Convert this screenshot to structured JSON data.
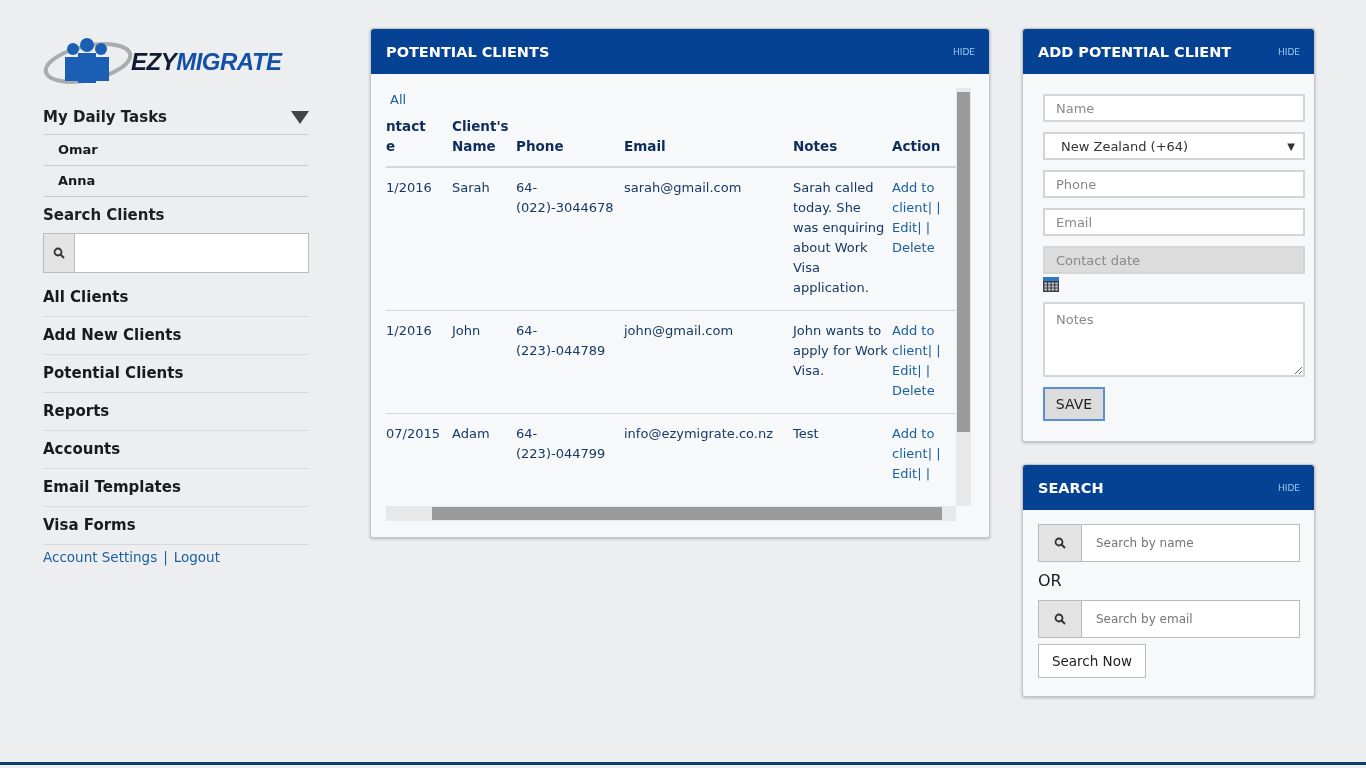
{
  "logo": {
    "part_1": "EZY",
    "part_2": "MIGRATE"
  },
  "sidebar": {
    "tasks": {
      "label": "My Daily Tasks",
      "expanded": true,
      "children": [
        {
          "label": "Omar"
        },
        {
          "label": "Anna"
        }
      ]
    },
    "search_heading": "Search Clients",
    "nav": [
      {
        "label": "All Clients"
      },
      {
        "label": "Add New Clients"
      },
      {
        "label": "Potential Clients"
      },
      {
        "label": "Reports"
      },
      {
        "label": "Accounts"
      },
      {
        "label": "Email Templates"
      },
      {
        "label": "Visa Forms"
      }
    ],
    "footer_links": [
      {
        "label": "Account Settings",
        "sep": "|"
      },
      {
        "label": "Logout"
      }
    ]
  },
  "potential_clients": {
    "title": "POTENTIAL CLIENTS",
    "hide": "HIDE",
    "view_all": "All",
    "columns": [
      {
        "line_1": "ntact",
        "line_2": "e"
      },
      {
        "line_1": "Client's",
        "line_2": "Name"
      },
      {
        "line_2": "Phone"
      },
      {
        "line_2": "Email"
      },
      {
        "line_2": "Notes"
      },
      {
        "line_2": "Action"
      }
    ],
    "rows": [
      {
        "date": "1/2016",
        "name": "Sarah",
        "phone": "64-(022)-3044678",
        "email": "sarah@gmail.com",
        "notes": "Sarah called today. She was enquiring about Work Visa application.",
        "actions": [
          {
            "label": "Add to client",
            "sep": "| |"
          },
          {
            "label": "Edit",
            "sep": "| |"
          },
          {
            "label": "Delete"
          }
        ]
      },
      {
        "date": "1/2016",
        "name": "John",
        "phone": "64-(223)-044789",
        "email": "john@gmail.com",
        "notes": "John wants to apply for Work Visa.",
        "actions": [
          {
            "label": "Add to client",
            "sep": "| |"
          },
          {
            "label": "Edit",
            "sep": "| |"
          },
          {
            "label": "Delete"
          }
        ]
      },
      {
        "date": "07/2015",
        "name": "Adam",
        "phone": "64-(223)-044799",
        "email": "info@ezymigrate.co.nz",
        "notes": "Test",
        "actions": [
          {
            "label": "Add to client",
            "sep": "| |"
          },
          {
            "label": "Edit",
            "sep": "| |"
          }
        ]
      }
    ]
  },
  "add_client": {
    "title": "ADD POTENTIAL CLIENT",
    "hide": "HIDE",
    "fields": [
      {
        "kind": "text",
        "placeholder": "Name"
      },
      {
        "kind": "select",
        "value": "New Zealand (+64)",
        "arrow": "▼"
      },
      {
        "kind": "text",
        "placeholder": "Phone"
      },
      {
        "kind": "text",
        "placeholder": "Email"
      },
      {
        "kind": "date",
        "placeholder": "Contact date",
        "disabled": true
      },
      {
        "kind": "textarea",
        "placeholder": "Notes"
      }
    ],
    "save": "SAVE"
  },
  "search": {
    "title": "SEARCH",
    "hide": "HIDE",
    "name_placeholder": "Search by name",
    "or": "OR",
    "email_placeholder": "Search by email",
    "button": "Search Now"
  }
}
